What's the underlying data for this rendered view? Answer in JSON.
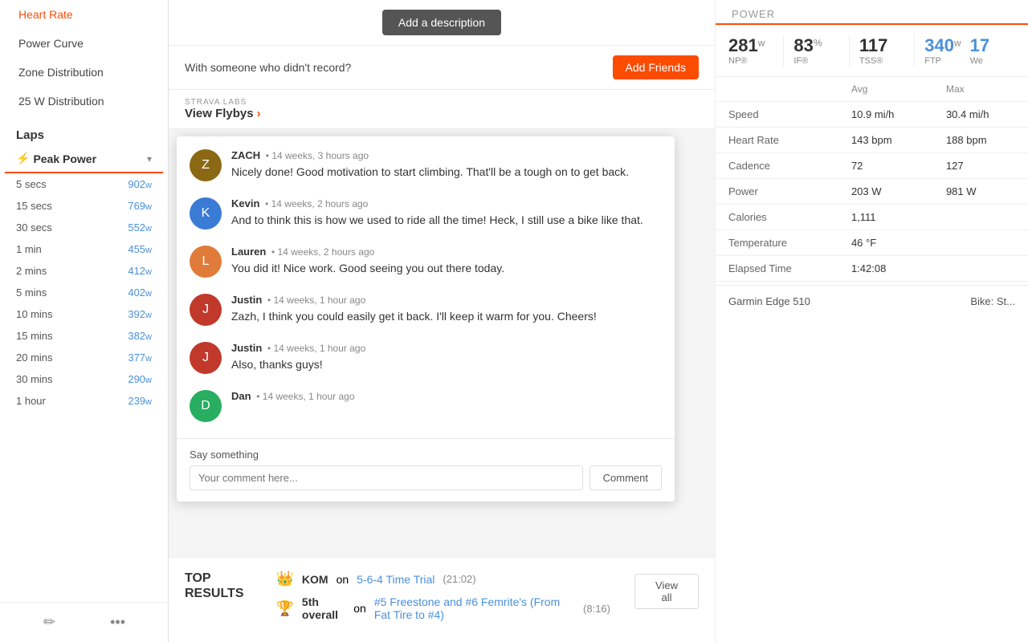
{
  "sidebar": {
    "nav_items": [
      {
        "label": "Heart Rate",
        "active": false
      },
      {
        "label": "Power Curve",
        "active": false
      },
      {
        "label": "Zone Distribution",
        "active": false
      },
      {
        "label": "25 W Distribution",
        "active": false
      }
    ],
    "laps_title": "Laps",
    "peak_power_label": "Peak Power",
    "power_rows": [
      {
        "duration": "5 secs",
        "value": "902",
        "unit": "w"
      },
      {
        "duration": "15 secs",
        "value": "769",
        "unit": "w"
      },
      {
        "duration": "30 secs",
        "value": "552",
        "unit": "w"
      },
      {
        "duration": "1 min",
        "value": "455",
        "unit": "w"
      },
      {
        "duration": "2 mins",
        "value": "412",
        "unit": "w"
      },
      {
        "duration": "5 mins",
        "value": "402",
        "unit": "w"
      },
      {
        "duration": "10 mins",
        "value": "392",
        "unit": "w"
      },
      {
        "duration": "15 mins",
        "value": "382",
        "unit": "w"
      },
      {
        "duration": "20 mins",
        "value": "377",
        "unit": "w"
      },
      {
        "duration": "30 mins",
        "value": "290",
        "unit": "w"
      },
      {
        "duration": "1 hour",
        "value": "239",
        "unit": "w"
      }
    ],
    "edit_icon": "✏",
    "more_icon": "•••"
  },
  "main": {
    "add_description_label": "Add a description",
    "with_someone_text": "With someone who didn't record?",
    "add_friends_label": "Add Friends",
    "strava_labs_label": "STRAVA LABS",
    "view_flybys_label": "View Flybys",
    "comments": [
      {
        "author": "ZACH",
        "time": "14 weeks, 3 hours ago",
        "text": "Nicely done! Good motivation to start climbing. That'll be a tough on to get back.",
        "avatar_letter": "Z",
        "avatar_class": "avatar-zach"
      },
      {
        "author": "Kevin",
        "time": "14 weeks, 2 hours ago",
        "text": "And to think this is how we used to ride all the time! Heck, I still use a bike like that.",
        "avatar_letter": "K",
        "avatar_class": "avatar-kevin"
      },
      {
        "author": "Lauren",
        "time": "14 weeks, 2 hours ago",
        "text": "You did it! Nice work. Good seeing you out there today.",
        "avatar_letter": "L",
        "avatar_class": "avatar-lauren"
      },
      {
        "author": "Justin",
        "time": "14 weeks, 1 hour ago",
        "text": "Zazh, I think you could easily get it back. I'll keep it warm for you. Cheers!",
        "avatar_letter": "J",
        "avatar_class": "avatar-justin1"
      },
      {
        "author": "Justin",
        "time": "14 weeks, 1 hour ago",
        "text": "Also, thanks guys!",
        "avatar_letter": "J",
        "avatar_class": "avatar-justin2"
      },
      {
        "author": "Dan",
        "time": "14 weeks, 1 hour ago",
        "text": "",
        "avatar_letter": "D",
        "avatar_class": "avatar-dan"
      }
    ],
    "say_something_label": "Say something",
    "comment_placeholder": "Your comment here...",
    "comment_btn_label": "Comment"
  },
  "bottom": {
    "top_results_title": "TOP\nRESULTS",
    "results": [
      {
        "icon": "👑",
        "label": "KOM",
        "pretext": "on",
        "link_text": "5-6-4 Time Trial",
        "time": "(21:02)"
      },
      {
        "icon": "🏆",
        "label": "5th overall",
        "pretext": "on",
        "link_text": "#5 Freestone and #6 Femrite's (From Fat Tire to #4)",
        "time": "(8:16)"
      }
    ],
    "view_all_label": "View all"
  },
  "right_panel": {
    "section_label": "Power",
    "stats": [
      {
        "value": "281",
        "unit": "w",
        "label": "NP®"
      },
      {
        "value": "83",
        "unit": "%",
        "label": "IF®"
      },
      {
        "value": "117",
        "unit": "",
        "label": "TSS®"
      }
    ],
    "ftp_value": "340",
    "ftp_unit": "w",
    "ftp_label": "FTP",
    "we_value": "17",
    "we_label": "We",
    "col_avg": "Avg",
    "col_max": "Max",
    "metrics": [
      {
        "label": "Speed",
        "avg": "10.9 mi/h",
        "max": "30.4 mi/h"
      },
      {
        "label": "Heart Rate",
        "avg": "143 bpm",
        "max": "188 bpm"
      },
      {
        "label": "Cadence",
        "avg": "72",
        "max": "127"
      },
      {
        "label": "Power",
        "avg": "203 W",
        "max": "981 W"
      },
      {
        "label": "Calories",
        "avg": "1,111",
        "max": ""
      },
      {
        "label": "Temperature",
        "avg": "46 °F",
        "max": ""
      },
      {
        "label": "Elapsed Time",
        "avg": "1:42:08",
        "max": ""
      }
    ],
    "device_label": "Garmin Edge 510",
    "bike_label": "Bike: St..."
  }
}
